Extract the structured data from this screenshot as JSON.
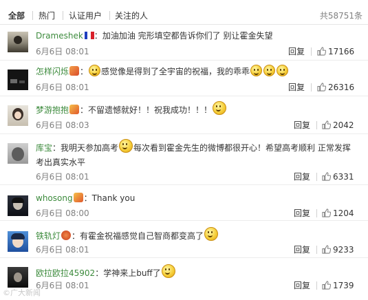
{
  "tabs": [
    {
      "label": "全部"
    },
    {
      "label": "热门"
    },
    {
      "label": "认证用户"
    },
    {
      "label": "关注的人"
    }
  ],
  "total": "共58751条",
  "reply_label": "回复",
  "comments": [
    {
      "user": "Drameshek",
      "sep": "：",
      "text": "加油加油 完形填空都告诉你们了 别让霍金失望",
      "time": "6月6日 08:01",
      "likes": "17166"
    },
    {
      "user": "怎样闪烁",
      "sep": "：",
      "text": "感觉像是得到了全宇宙的祝福，我的乖乖",
      "time": "6月6日 08:01",
      "likes": "26316"
    },
    {
      "user": "梦游抱抱",
      "sep": "：",
      "text": "不留遗憾就好！！祝我成功！！！",
      "time": "6月6日 08:03",
      "likes": "2042"
    },
    {
      "user": "库宝",
      "sep": "：",
      "text_a": "我明天参加高考",
      "text_b": "每次看到霍金先生的微博都很开心！希望高考顺利 正常发挥",
      "text_c": "考出真实水平",
      "time": "6月6日 08:01",
      "likes": "6331"
    },
    {
      "user": "whosong",
      "sep": "：",
      "text": "Thank you",
      "time": "6月6日 08:00",
      "likes": "1204"
    },
    {
      "user": "铁轨灯",
      "sep": "：",
      "text": "有霍金祝福感觉自己智商都变高了",
      "time": "6月6日 08:01",
      "likes": "9233"
    },
    {
      "user": "欧拉欧拉45902",
      "sep": "：",
      "text": "学神来上buff了",
      "time": "6月6日 08:01",
      "likes": "1739"
    }
  ],
  "watermark": "©广大新闻"
}
